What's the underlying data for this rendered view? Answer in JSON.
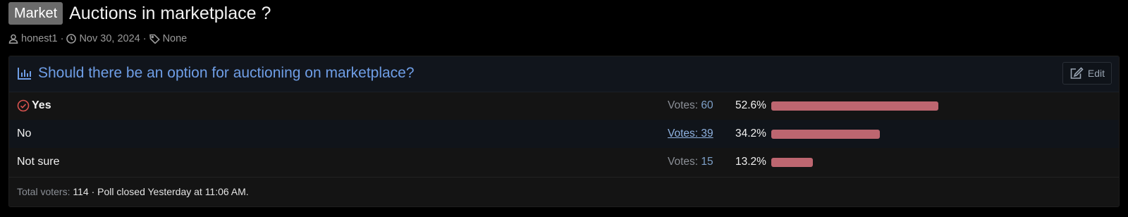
{
  "thread": {
    "prefix": "Market",
    "title": "Auctions in marketplace ?",
    "author": "honest1",
    "date": "Nov 30, 2024",
    "tags": "None"
  },
  "poll": {
    "question": "Should there be an option for auctioning on marketplace?",
    "edit_label": "Edit",
    "votes_label": "Votes:",
    "options": [
      {
        "label": "Yes",
        "votes": "60",
        "percent": "52.6%",
        "fraction": 0.526,
        "voted": true
      },
      {
        "label": "No",
        "votes": "39",
        "percent": "34.2%",
        "fraction": 0.342,
        "voted": false
      },
      {
        "label": "Not sure",
        "votes": "15",
        "percent": "13.2%",
        "fraction": 0.132,
        "voted": false
      }
    ],
    "footer": {
      "total_label": "Total voters:",
      "total_value": "114",
      "closed_text": "· Poll closed Yesterday at 11:06 AM."
    }
  },
  "colors": {
    "bar": "#bd6670",
    "accent": "#6f9ee6",
    "prefix_bg": "#6b6b6b"
  }
}
